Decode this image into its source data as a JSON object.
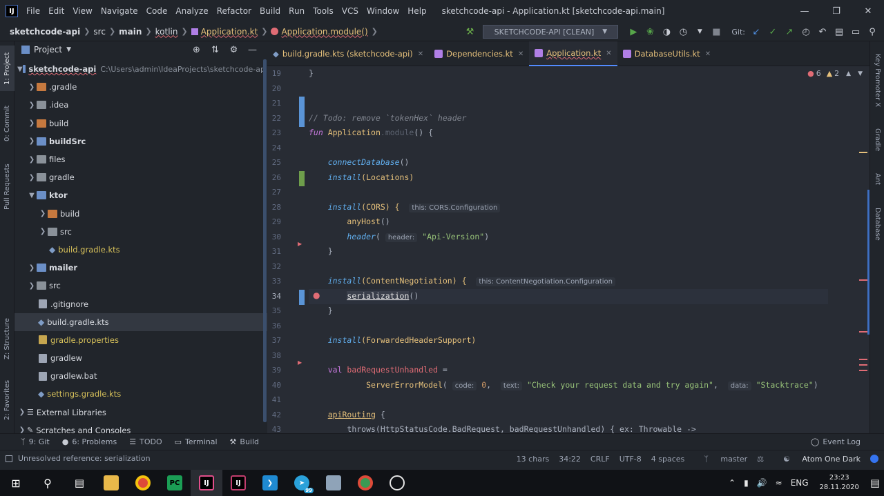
{
  "menubar": {
    "logo": "IJ",
    "items": [
      "File",
      "Edit",
      "View",
      "Navigate",
      "Code",
      "Analyze",
      "Refactor",
      "Build",
      "Run",
      "Tools",
      "VCS",
      "Window",
      "Help"
    ],
    "title": "sketchcode-api - Application.kt [sketchcode-api.main]"
  },
  "breadcrumbs": [
    "sketchcode-api",
    "src",
    "main",
    "kotlin",
    "Application.kt",
    "Application.module()"
  ],
  "run_config": "SKETCHCODE-API [CLEAN]",
  "git_label": "Git:",
  "project_panel": {
    "title": "Project",
    "tree": [
      {
        "name": "sketchcode-api",
        "path": "C:\\Users\\admin\\IdeaProjects\\sketchcode-api"
      },
      {
        "name": ".gradle"
      },
      {
        "name": ".idea"
      },
      {
        "name": "build"
      },
      {
        "name": "buildSrc"
      },
      {
        "name": "files"
      },
      {
        "name": "gradle"
      },
      {
        "name": "ktor"
      },
      {
        "name": "build"
      },
      {
        "name": "src"
      },
      {
        "name": "build.gradle.kts"
      },
      {
        "name": "mailer"
      },
      {
        "name": "src"
      },
      {
        "name": ".gitignore"
      },
      {
        "name": "build.gradle.kts"
      },
      {
        "name": "gradle.properties"
      },
      {
        "name": "gradlew"
      },
      {
        "name": "gradlew.bat"
      },
      {
        "name": "settings.gradle.kts"
      },
      {
        "name": "External Libraries"
      },
      {
        "name": "Scratches and Consoles"
      }
    ]
  },
  "left_tool_tabs": [
    "1: Project",
    "0: Commit",
    "Pull Requests",
    "Z: Structure",
    "2: Favorites"
  ],
  "right_tool_tabs": [
    "Key Promoter X",
    "Gradle",
    "Ant",
    "Database"
  ],
  "editor_tabs": [
    {
      "label": "build.gradle.kts (sketchcode-api)"
    },
    {
      "label": "Dependencies.kt"
    },
    {
      "label": "Application.kt"
    },
    {
      "label": "DatabaseUtils.kt"
    }
  ],
  "inspections": {
    "errors": "6",
    "warnings": "2"
  },
  "line_numbers": [
    "19",
    "20",
    "21",
    "22",
    "23",
    "24",
    "25",
    "26",
    "27",
    "28",
    "29",
    "30",
    "31",
    "32",
    "33",
    "34",
    "35",
    "36",
    "37",
    "38",
    "39",
    "40",
    "41",
    "42",
    "43"
  ],
  "code": {
    "l19": "}",
    "l22": "// Todo: remove `tokenHex` header",
    "l23_kw": "fun",
    "l23_a": "Application",
    "l23_b": ".module",
    "l23_c": "() {",
    "l25": "connectDatabase",
    "l25b": "()",
    "l26a": "install",
    "l26b": "(Locations)",
    "l28a": "install",
    "l28b": "(CORS) {",
    "l28h": "this: CORS.Configuration",
    "l29a": "anyHost",
    "l29b": "()",
    "l30a": "header",
    "l30b": "(",
    "l30h": "header:",
    "l30s": "\"Api-Version\"",
    "l30c": ")",
    "l31": "}",
    "l33a": "install",
    "l33b": "(ContentNegotiation) {",
    "l33h": "this: ContentNegotiation.Configuration",
    "l34a": "serialization",
    "l34b": "()",
    "l35": "}",
    "l37a": "install",
    "l37b": "(ForwardedHeaderSupport)",
    "l39kw": "val",
    "l39a": "badRequestUnhandled",
    "l39b": " =",
    "l40a": "ServerErrorModel",
    "l40b": "(",
    "l40h1": "code:",
    "l40n": "0",
    "l40h2": "text:",
    "l40s1": "\"Check your request data and try again\"",
    "l40h3": "data:",
    "l40s2": "\"Stacktrace\"",
    "l40c": ")",
    "l42a": "apiRouting",
    "l42b": " {",
    "l43": "throws(HttpStatusCode.BadRequest, badRequestUnhandled) { ex: Throwable ->"
  },
  "bottom_tools": [
    "9: Git",
    "6: Problems",
    "TODO",
    "Terminal",
    "Build"
  ],
  "event_log": "Event Log",
  "status": {
    "message": "Unresolved reference: serialization",
    "chars": "13 chars",
    "position": "34:22",
    "line_sep": "CRLF",
    "encoding": "UTF-8",
    "indent": "4 spaces",
    "branch": "master",
    "theme": "Atom One Dark"
  },
  "taskbar": {
    "lang": "ENG",
    "time": "23:23",
    "date": "28.11.2020",
    "telegram_badge": "99"
  }
}
